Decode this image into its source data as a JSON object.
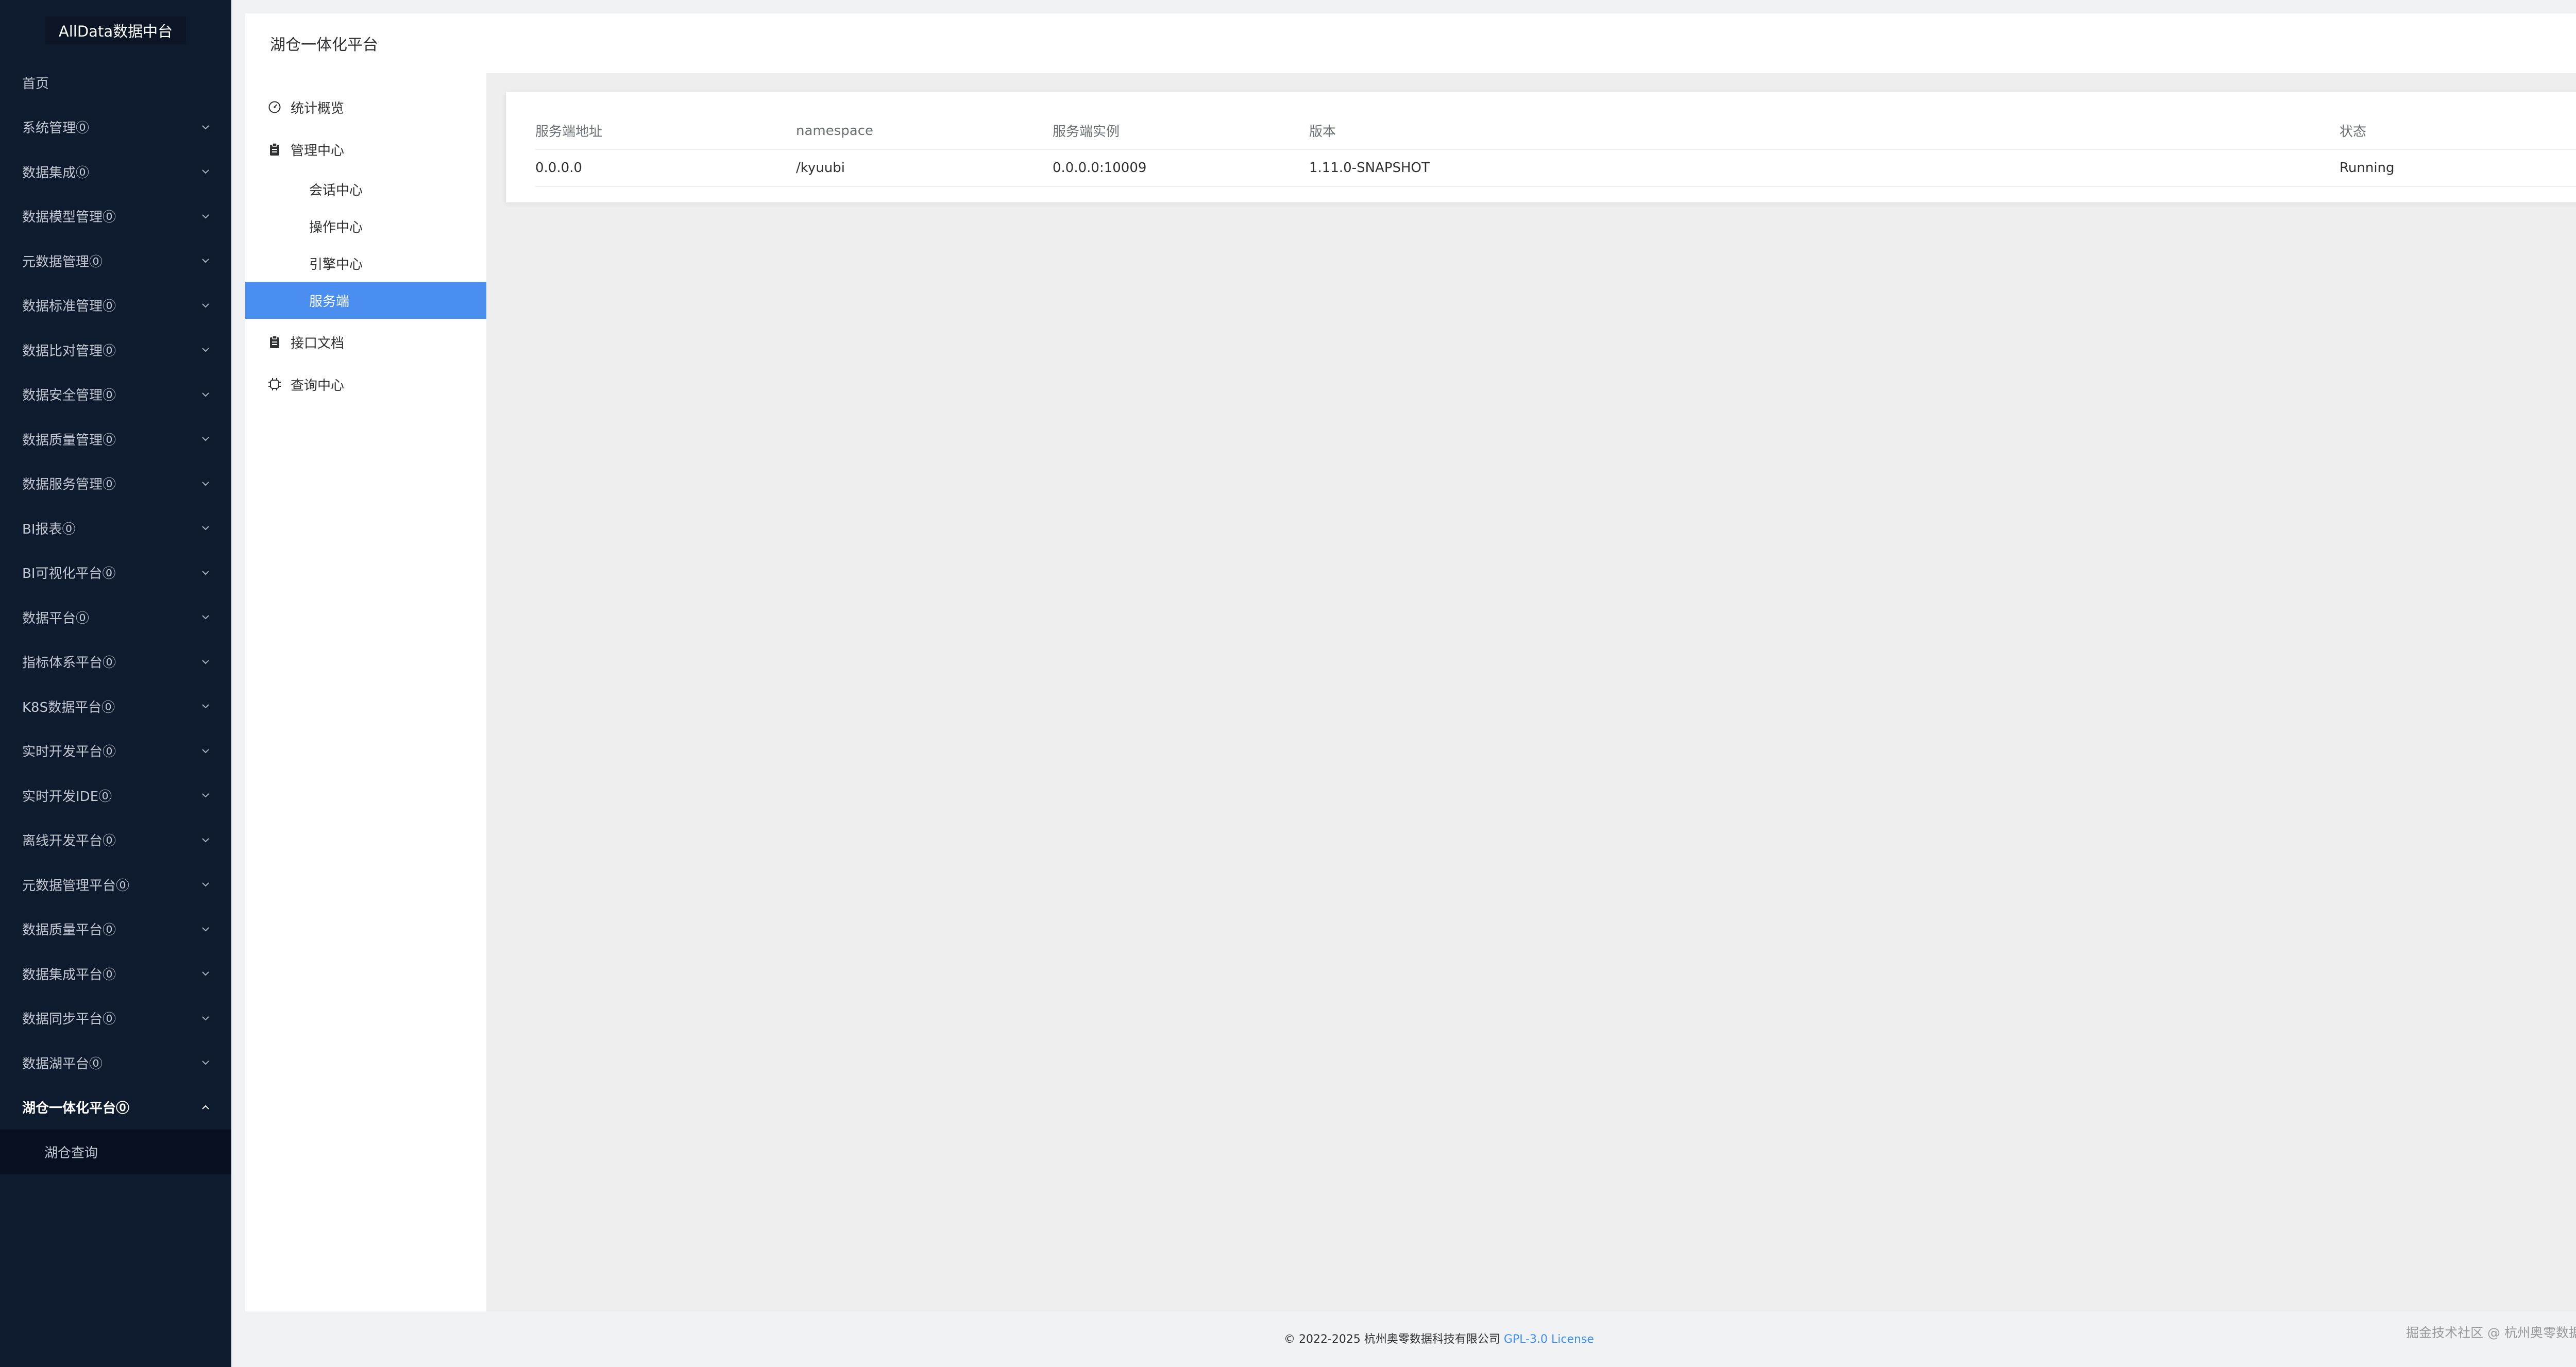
{
  "app": {
    "logo": "AllData数据中台"
  },
  "sidebar": {
    "items": [
      {
        "label": "首页",
        "has_arrow": false
      },
      {
        "label": "系统管理⓪",
        "has_arrow": true
      },
      {
        "label": "数据集成⓪",
        "has_arrow": true
      },
      {
        "label": "数据模型管理⓪",
        "has_arrow": true
      },
      {
        "label": "元数据管理⓪",
        "has_arrow": true
      },
      {
        "label": "数据标准管理⓪",
        "has_arrow": true
      },
      {
        "label": "数据比对管理⓪",
        "has_arrow": true
      },
      {
        "label": "数据安全管理⓪",
        "has_arrow": true
      },
      {
        "label": "数据质量管理⓪",
        "has_arrow": true
      },
      {
        "label": "数据服务管理⓪",
        "has_arrow": true
      },
      {
        "label": "BI报表⓪",
        "has_arrow": true
      },
      {
        "label": "BI可视化平台⓪",
        "has_arrow": true
      },
      {
        "label": "数据平台⓪",
        "has_arrow": true
      },
      {
        "label": "指标体系平台⓪",
        "has_arrow": true
      },
      {
        "label": "K8S数据平台⓪",
        "has_arrow": true
      },
      {
        "label": "实时开发平台⓪",
        "has_arrow": true
      },
      {
        "label": "实时开发IDE⓪",
        "has_arrow": true
      },
      {
        "label": "离线开发平台⓪",
        "has_arrow": true
      },
      {
        "label": "元数据管理平台⓪",
        "has_arrow": true
      },
      {
        "label": "数据质量平台⓪",
        "has_arrow": true
      },
      {
        "label": "数据集成平台⓪",
        "has_arrow": true
      },
      {
        "label": "数据同步平台⓪",
        "has_arrow": true
      },
      {
        "label": "数据湖平台⓪",
        "has_arrow": true
      },
      {
        "label": "湖仓一体化平台⓪",
        "has_arrow": true,
        "expanded": true
      }
    ],
    "submenu": [
      {
        "label": "湖仓查询"
      }
    ]
  },
  "header": {
    "title": "湖仓一体化平台"
  },
  "module_menu": {
    "overview": "统计概览",
    "management": "管理中心",
    "management_children": [
      "会话中心",
      "操作中心",
      "引擎中心",
      "服务端"
    ],
    "active_child": "服务端",
    "api_docs": "接口文档",
    "query_center": "查询中心"
  },
  "table": {
    "columns": [
      "服务端地址",
      "namespace",
      "服务端实例",
      "版本",
      "状态"
    ],
    "rows": [
      [
        "0.0.0.0",
        "/kyuubi",
        "0.0.0.0:10009",
        "1.11.0-SNAPSHOT",
        "Running"
      ]
    ]
  },
  "footer": {
    "copyright": "© 2022-2025 杭州奥零数据科技有限公司",
    "license": "GPL-3.0 License",
    "community": "掘金技术社区 @ 杭州奥零数据科技"
  },
  "colors": {
    "sidebar_bg": "#0e1a2e",
    "accent": "#4a8ff0",
    "link": "#3d8ff2"
  }
}
